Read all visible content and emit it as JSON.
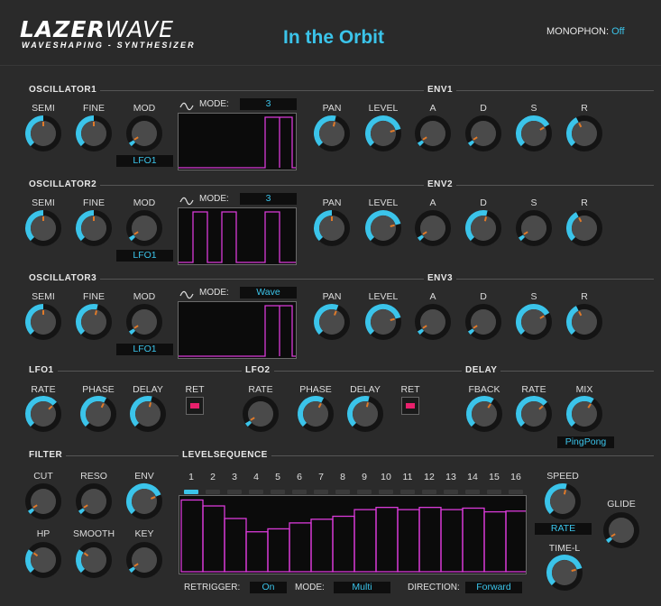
{
  "header": {
    "logo_main_bold": "LAZER",
    "logo_main_thin": "WAVE",
    "logo_sub": "WAVESHAPING - SYNTHESIZER",
    "preset_name": "In the Orbit",
    "mono_label": "MONOPHON:",
    "mono_value": "Off"
  },
  "colors": {
    "accent": "#3bc4ea",
    "wave": "#d93ad8",
    "panel": "#2b2b2b",
    "knob_track": "#141414",
    "indicator": "#e07a2a",
    "ret_led": "#e8206c"
  },
  "osc": [
    {
      "title": "OSCILLATOR1",
      "mode_label": "MODE:",
      "mode_value": "3",
      "mod_source": "LFO1",
      "knobs": [
        {
          "label": "SEMI",
          "value": 0.5
        },
        {
          "label": "FINE",
          "value": 0.5
        },
        {
          "label": "MOD",
          "value": 0.05
        }
      ],
      "wave_icon": "sine-wave-icon"
    },
    {
      "title": "OSCILLATOR2",
      "mode_label": "MODE:",
      "mode_value": "3",
      "mod_source": "LFO1",
      "knobs": [
        {
          "label": "SEMI",
          "value": 0.5
        },
        {
          "label": "FINE",
          "value": 0.5
        },
        {
          "label": "MOD",
          "value": 0.05
        }
      ],
      "wave_icon": "sine-wave-icon"
    },
    {
      "title": "OSCILLATOR3",
      "mode_label": "MODE:",
      "mode_value": "Wave",
      "mod_source": "LFO1",
      "knobs": [
        {
          "label": "SEMI",
          "value": 0.5
        },
        {
          "label": "FINE",
          "value": 0.55
        },
        {
          "label": "MOD",
          "value": 0.05
        }
      ],
      "wave_icon": "sine-wave-icon"
    }
  ],
  "env": [
    {
      "title": "ENV1",
      "knobs": [
        {
          "label": "PAN",
          "value": 0.55
        },
        {
          "label": "LEVEL",
          "value": 0.78
        },
        {
          "label": "A",
          "value": 0.05
        },
        {
          "label": "D",
          "value": 0.05
        },
        {
          "label": "S",
          "value": 0.72
        },
        {
          "label": "R",
          "value": 0.4
        }
      ]
    },
    {
      "title": "ENV2",
      "knobs": [
        {
          "label": "PAN",
          "value": 0.5
        },
        {
          "label": "LEVEL",
          "value": 0.78
        },
        {
          "label": "A",
          "value": 0.05
        },
        {
          "label": "D",
          "value": 0.55
        },
        {
          "label": "S",
          "value": 0.05
        },
        {
          "label": "R",
          "value": 0.4
        }
      ]
    },
    {
      "title": "ENV3",
      "knobs": [
        {
          "label": "PAN",
          "value": 0.58
        },
        {
          "label": "LEVEL",
          "value": 0.78
        },
        {
          "label": "A",
          "value": 0.05
        },
        {
          "label": "D",
          "value": 0.05
        },
        {
          "label": "S",
          "value": 0.72
        },
        {
          "label": "R",
          "value": 0.4
        }
      ]
    }
  ],
  "lfo": [
    {
      "title": "LFO1",
      "knobs": [
        {
          "label": "RATE",
          "value": 0.68
        },
        {
          "label": "PHASE",
          "value": 0.6
        },
        {
          "label": "DELAY",
          "value": 0.55
        }
      ],
      "ret_label": "RET"
    },
    {
      "title": "LFO2",
      "knobs": [
        {
          "label": "RATE",
          "value": 0.05
        },
        {
          "label": "PHASE",
          "value": 0.6
        },
        {
          "label": "DELAY",
          "value": 0.55
        }
      ],
      "ret_label": "RET"
    }
  ],
  "delay": {
    "title": "DELAY",
    "knobs": [
      {
        "label": "FBACK",
        "value": 0.62
      },
      {
        "label": "RATE",
        "value": 0.68
      },
      {
        "label": "MIX",
        "value": 0.62
      }
    ],
    "mode_value": "PingPong"
  },
  "filter": {
    "title": "FILTER",
    "knobs": [
      {
        "label": "CUT",
        "value": 0.05
      },
      {
        "label": "RESO",
        "value": 0.05
      },
      {
        "label": "ENV",
        "value": 0.75
      },
      {
        "label": "HP",
        "value": 0.3
      },
      {
        "label": "SMOOTH",
        "value": 0.3
      },
      {
        "label": "KEY",
        "value": 0.05
      }
    ]
  },
  "levelseq": {
    "title": "LEVELSEQUENCE",
    "steps": [
      "1",
      "2",
      "3",
      "4",
      "5",
      "6",
      "7",
      "8",
      "9",
      "10",
      "11",
      "12",
      "13",
      "14",
      "15",
      "16"
    ],
    "active_step": 0,
    "levels": [
      0.97,
      0.89,
      0.72,
      0.54,
      0.58,
      0.66,
      0.71,
      0.75,
      0.84,
      0.87,
      0.84,
      0.87,
      0.84,
      0.86,
      0.81,
      0.82
    ],
    "retrigger_label": "RETRIGGER:",
    "retrigger_value": "On",
    "mode_label": "MODE:",
    "mode_value": "Multi",
    "direction_label": "DIRECTION:",
    "direction_value": "Forward",
    "speed_label": "SPEED",
    "speed_value": 0.55,
    "speed_mode": "RATE",
    "glide_label": "GLIDE",
    "glide_value": 0.05,
    "timel_label": "TIME-L",
    "timel_value": 0.78
  }
}
